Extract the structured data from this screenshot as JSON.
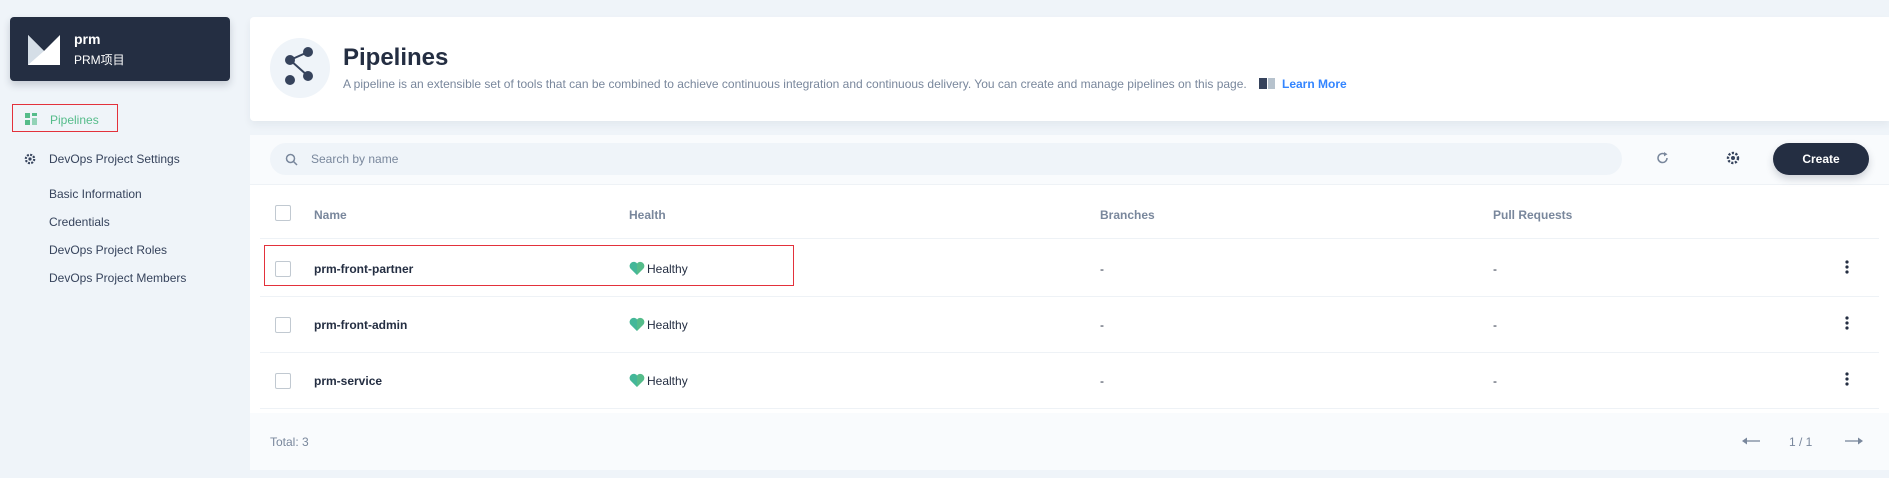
{
  "project": {
    "name": "prm",
    "description": "PRM项目"
  },
  "sidebar": {
    "pipelines_label": "Pipelines",
    "settings_label": "DevOps Project Settings",
    "settings_items": [
      "Basic Information",
      "Credentials",
      "DevOps Project Roles",
      "DevOps Project Members"
    ]
  },
  "header": {
    "title": "Pipelines",
    "description": "A pipeline is an extensible set of tools that can be combined to achieve continuous integration and continuous delivery. You can create and manage pipelines on this page.",
    "learn_more": "Learn More"
  },
  "toolbar": {
    "search_placeholder": "Search by name",
    "create_label": "Create"
  },
  "table": {
    "columns": [
      "Name",
      "Health",
      "Branches",
      "Pull Requests"
    ],
    "rows": [
      {
        "name": "prm-front-partner",
        "health": "Healthy",
        "branches": "-",
        "pull_requests": "-"
      },
      {
        "name": "prm-front-admin",
        "health": "Healthy",
        "branches": "-",
        "pull_requests": "-"
      },
      {
        "name": "prm-service",
        "health": "Healthy",
        "branches": "-",
        "pull_requests": "-"
      }
    ]
  },
  "footer": {
    "total": "Total: 3",
    "page": "1 / 1"
  },
  "colors": {
    "accent": "#55bc8a",
    "dark": "#242e42",
    "link": "#3385ff",
    "highlight": "#e3313b"
  }
}
